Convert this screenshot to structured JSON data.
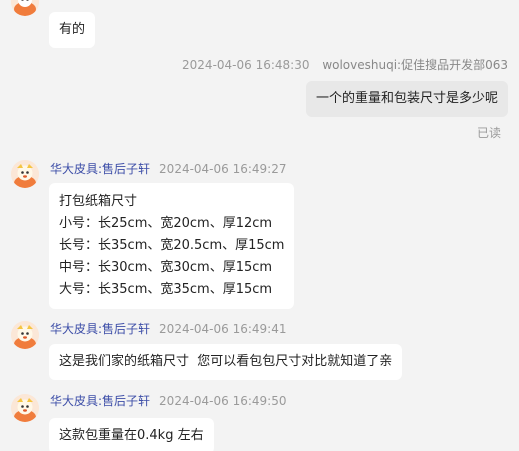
{
  "messages": [
    {
      "side": "left",
      "lines": [
        "有的"
      ]
    },
    {
      "side": "right",
      "timestamp": "2024-04-06 16:48:30",
      "sender": "woloveshuqi:促佳搜品开发部063",
      "lines": [
        "一个的重量和包装尺寸是多少呢"
      ],
      "status": "已读"
    },
    {
      "side": "left",
      "sender": "华大皮具:售后子轩",
      "timestamp": "2024-04-06 16:49:27",
      "lines": [
        "打包纸箱尺寸",
        "小号：长25cm、宽20cm、厚12cm",
        "长号：长35cm、宽20.5cm、厚15cm",
        "中号：长30cm、宽30cm、厚15cm",
        "大号：长35cm、宽35cm、厚15cm"
      ]
    },
    {
      "side": "left",
      "sender": "华大皮具:售后子轩",
      "timestamp": "2024-04-06 16:49:41",
      "lines": [
        "这是我们家的纸箱尺寸  您可以看包包尺寸对比就知道了亲"
      ]
    },
    {
      "side": "left",
      "sender": "华大皮具:售后子轩",
      "timestamp": "2024-04-06 16:49:50",
      "lines": [
        "这款包重量在0.4kg 左右"
      ]
    }
  ],
  "colors": {
    "background": "#f3f3f3",
    "bubble_left": "#ffffff",
    "bubble_self": "#e8e8e8",
    "sender_name": "#3e4fa8",
    "meta_gray": "#9a9a9a",
    "avatar_accent": "#f07c3c"
  }
}
